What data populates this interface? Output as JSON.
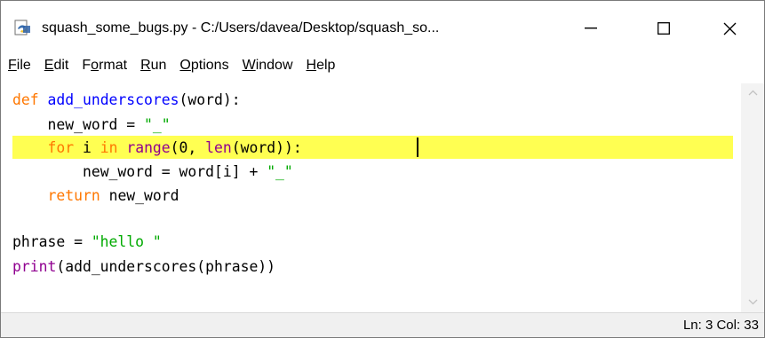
{
  "window": {
    "title": "squash_some_bugs.py - C:/Users/davea/Desktop/squash_so..."
  },
  "menu": {
    "items": [
      {
        "mnemonic": "F",
        "rest": "ile"
      },
      {
        "mnemonic": "E",
        "rest": "dit"
      },
      {
        "pre": "F",
        "mnemonic": "o",
        "rest": "rmat"
      },
      {
        "mnemonic": "R",
        "rest": "un"
      },
      {
        "mnemonic": "O",
        "rest": "ptions"
      },
      {
        "mnemonic": "W",
        "rest": "indow"
      },
      {
        "mnemonic": "H",
        "rest": "elp"
      }
    ]
  },
  "editor": {
    "highlighted_line": 3,
    "code": {
      "l1": {
        "kw": "def",
        "sp": " ",
        "name": "add_underscores",
        "rest": "(word):"
      },
      "l2": {
        "indent": "    ",
        "a": "new_word = ",
        "str": "\"_\""
      },
      "l3": {
        "indent": "    ",
        "kw1": "for",
        "a": " i ",
        "kw2": "in",
        "sp": " ",
        "bi1": "range",
        "b": "(0, ",
        "bi2": "len",
        "c": "(word)):"
      },
      "l4": {
        "indent": "        ",
        "a": "new_word = word[i] + ",
        "str": "\"_\""
      },
      "l5": {
        "indent": "    ",
        "kw": "return",
        "a": " new_word"
      },
      "l6": {
        "a": "phrase = ",
        "str": "\"hello \""
      },
      "l7": {
        "bi": "print",
        "a": "(add_underscores(phrase))"
      }
    }
  },
  "status": {
    "text": "Ln: 3   Col: 33"
  }
}
